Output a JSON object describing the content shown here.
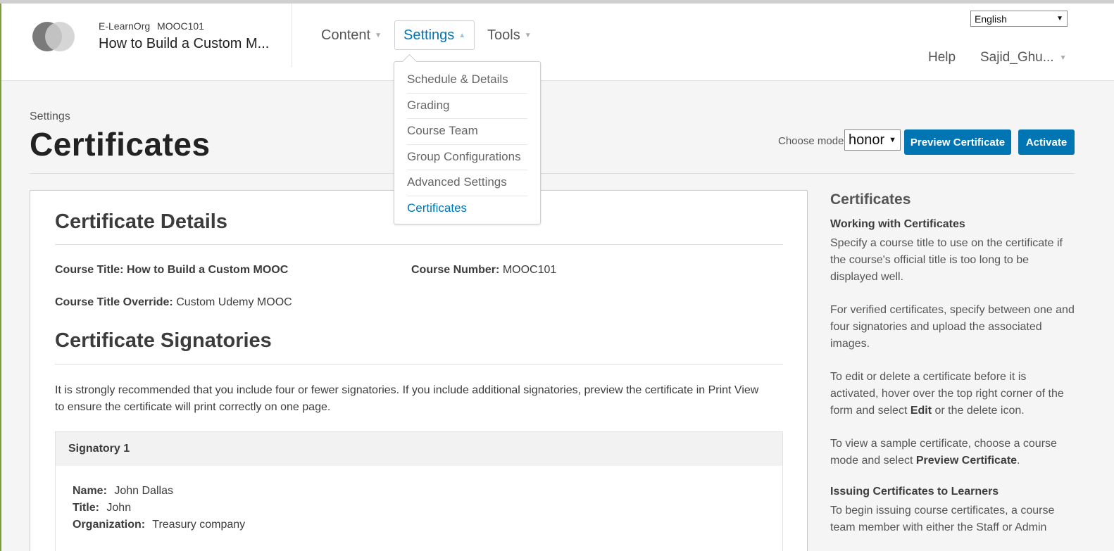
{
  "header": {
    "org": "E-LearnOrg",
    "course_number": "MOOC101",
    "course_title": "How to Build a Custom M...",
    "nav": {
      "content": "Content",
      "settings": "Settings",
      "tools": "Tools"
    },
    "language": "English",
    "help": "Help",
    "user": "Sajid_Ghu..."
  },
  "settings_menu": {
    "items": [
      {
        "label": "Schedule & Details"
      },
      {
        "label": "Grading"
      },
      {
        "label": "Course Team"
      },
      {
        "label": "Group Configurations"
      },
      {
        "label": "Advanced Settings"
      },
      {
        "label": "Certificates"
      }
    ]
  },
  "page": {
    "breadcrumb": "Settings",
    "title": "Certificates",
    "mode_label": "Choose mode",
    "mode_value": "honor",
    "preview_button": "Preview Certificate",
    "activate_button": "Activate"
  },
  "details": {
    "heading": "Certificate Details",
    "course_title_label": "Course Title:",
    "course_title_value": "How to Build a Custom MOOC",
    "course_number_label": "Course Number:",
    "course_number_value": "MOOC101",
    "override_label": "Course Title Override:",
    "override_value": "Custom Udemy MOOC"
  },
  "signatories": {
    "heading": "Certificate Signatories",
    "note": "It is strongly recommended that you include four or fewer signatories. If you include additional signatories, preview the certificate in Print View to ensure the certificate will print correctly on one page.",
    "items": [
      {
        "header": "Signatory 1",
        "name_label": "Name:",
        "name": "John Dallas",
        "title_label": "Title:",
        "title": "John",
        "org_label": "Organization:",
        "org": "Treasury company"
      }
    ]
  },
  "sidebar": {
    "heading": "Certificates",
    "sub1": "Working with Certificates",
    "p1": "Specify a course title to use on the certificate if the course's official title is too long to be displayed well.",
    "p2": "For verified certificates, specify between one and four signatories and upload the associated images.",
    "p3_a": "To edit or delete a certificate before it is activated, hover over the top right corner of the form and select ",
    "p3_b": "Edit",
    "p3_c": " or the delete icon.",
    "p4_a": "To view a sample certificate, choose a course mode and select ",
    "p4_b": "Preview Certificate",
    "p4_c": ".",
    "sub2": "Issuing Certificates to Learners",
    "p5": "To begin issuing course certificates, a course team member with either the Staff or Admin"
  },
  "colors": {
    "accent": "#0075b4",
    "text": "#3c3c3c",
    "background": "#f5f5f5"
  }
}
